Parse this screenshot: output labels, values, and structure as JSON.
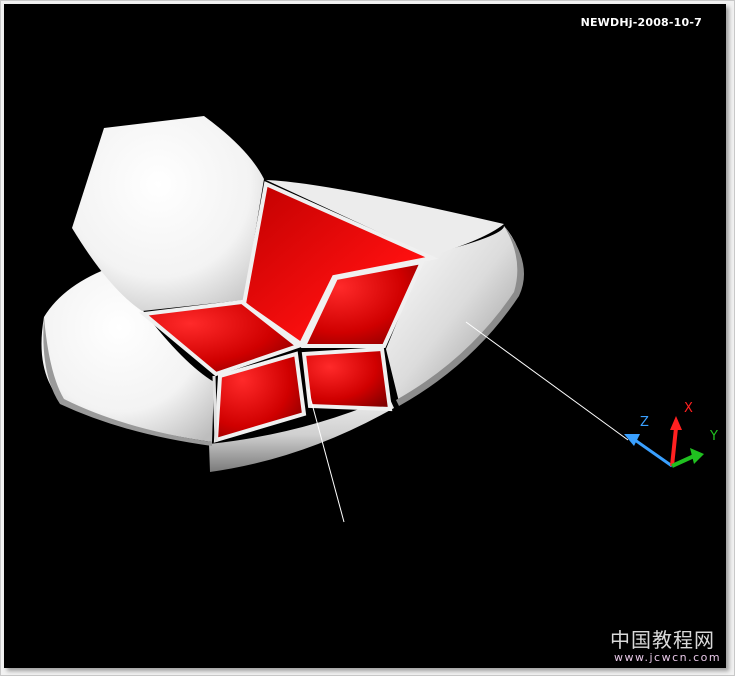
{
  "stamp": {
    "text": "NEWDHj-2008-10-7"
  },
  "ucs_icon": {
    "z_label": "Z",
    "x_label": "X",
    "y_label": "Y",
    "z_color": "#3aa0ff",
    "x_color": "#ff2020",
    "y_color": "#20c020"
  },
  "model": {
    "accent_color": "#cc0000",
    "body_color": "#ffffff"
  },
  "watermark": {
    "chinese": "中国教程网",
    "url": "www.jcwcn.com"
  }
}
